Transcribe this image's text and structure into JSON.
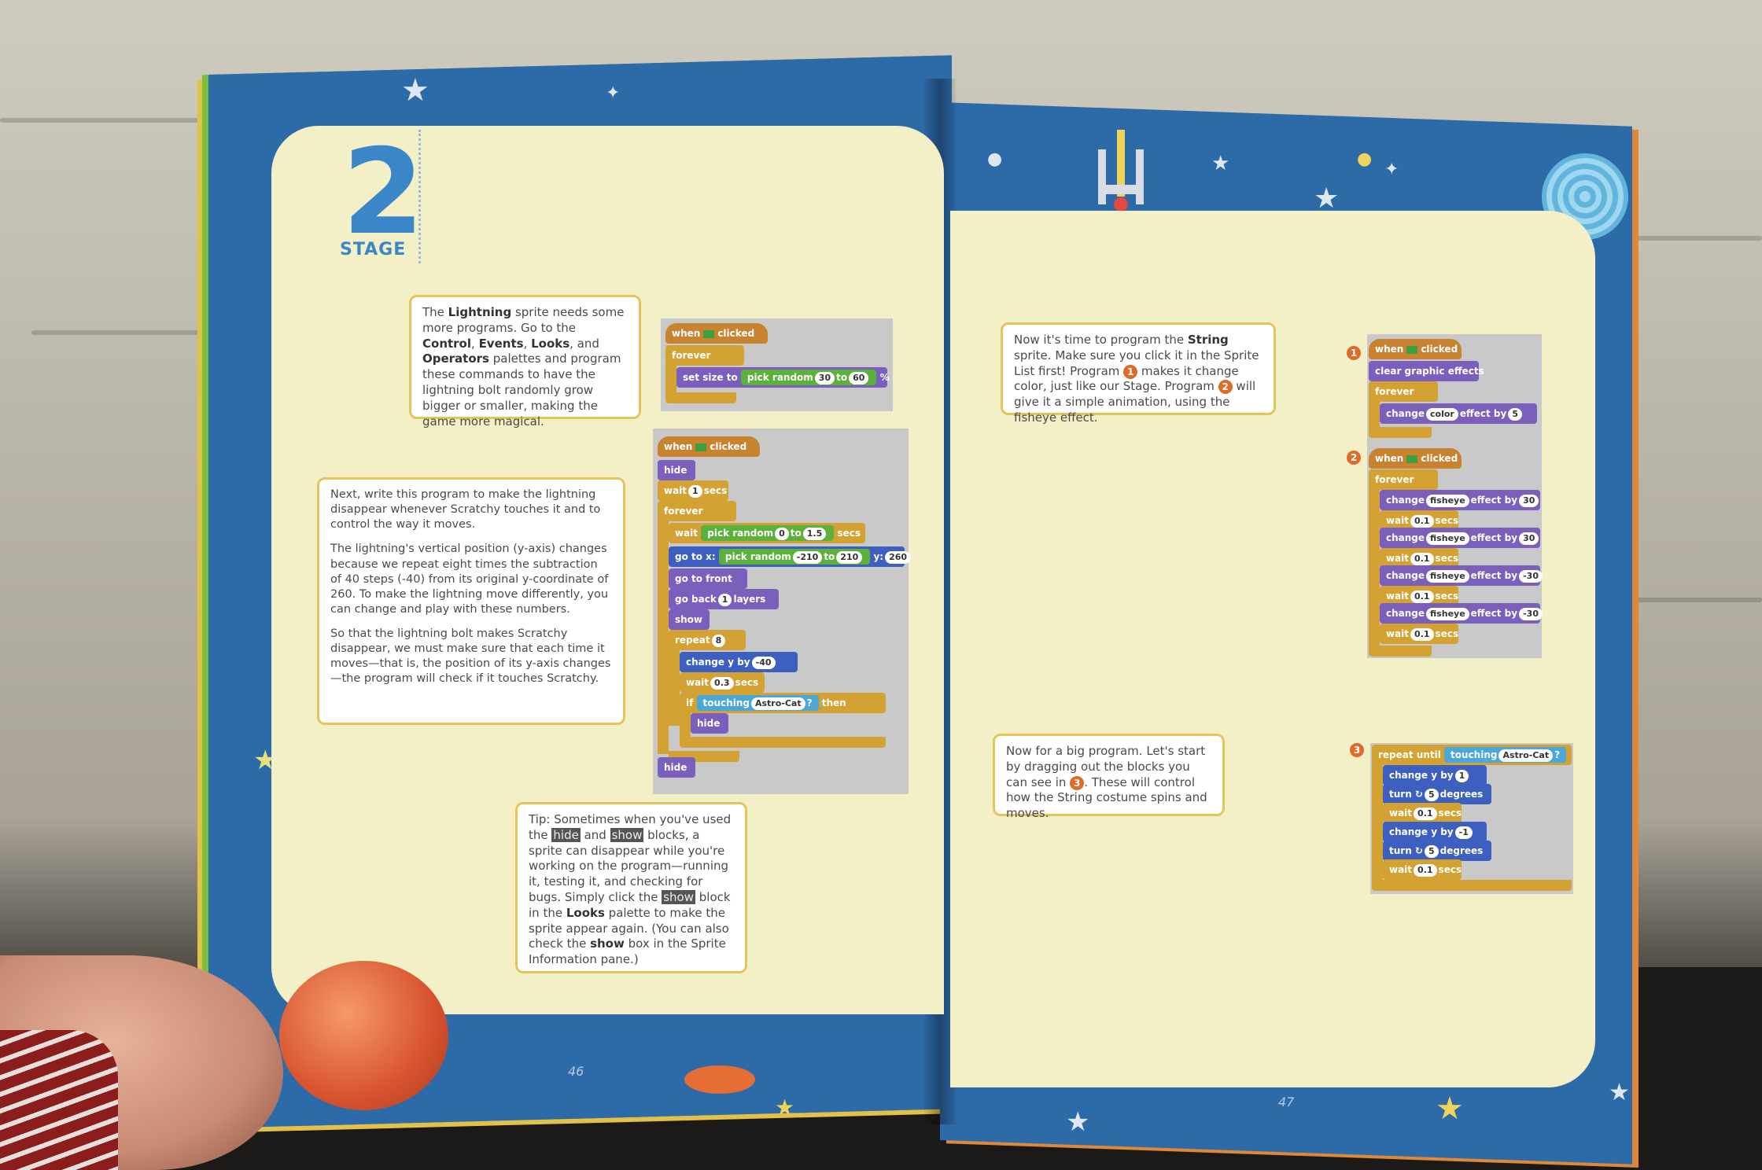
{
  "stage": {
    "number": "2",
    "word": "STAGE"
  },
  "left_page": {
    "page_number": "46",
    "note1": {
      "t1": "The ",
      "b1": "Lightning",
      "t2": " sprite needs some more programs. Go to the ",
      "b2": "Control",
      "t3": ", ",
      "b3": "Events",
      "t4": ", ",
      "b4": "Looks",
      "t5": ", and ",
      "b5": "Operators",
      "t6": " palettes and program these commands to have the lightning bolt randomly grow bigger or smaller, making the game more magical."
    },
    "note2": {
      "p1": "Next, write this program to make the lightning disappear whenever Scratchy touches it and to control the way it moves.",
      "p2": "The lightning's vertical position (y-axis) changes because we repeat eight times the subtraction of 40 steps (-40) from its original y-coordinate of 260. To make the lightning move differently, you can change and play with these numbers.",
      "p3": "So that the lightning bolt makes Scratchy disappear, we must make sure that each time it moves—that is, the position of its y-axis changes—the program will check if it touches Scratchy."
    },
    "tip": {
      "t1": "Tip: Sometimes when you've used the ",
      "h1": "hide",
      "t2": " and ",
      "h2": "show",
      "t3": " blocks, a sprite can disappear while you're working on the program—running it, testing it, and checking for bugs. Simply click the ",
      "h3": "show",
      "t4": " block in the ",
      "b1": "Looks",
      "t5": " palette to make the sprite appear again. (You can also check the ",
      "b2": "show",
      "t6": " box in the Sprite Information pane.)"
    },
    "code1": {
      "when": "when",
      "clicked": "clicked",
      "forever": "forever",
      "set_size": "set size to",
      "pick_random": "pick random",
      "to": "to",
      "a": "30",
      "b": "60",
      "pct": "%"
    },
    "code2": {
      "when": "when",
      "clicked": "clicked",
      "hide": "hide",
      "wait": "wait",
      "w1": "1",
      "secs": "secs",
      "forever": "forever",
      "pick_random": "pick random",
      "to": "to",
      "r1": "0",
      "r2": "1.5",
      "goto": "go to x:",
      "x1": "-210",
      "x2": "210",
      "y": "y:",
      "yv": "260",
      "front": "go to front",
      "goback": "go back",
      "layers_n": "1",
      "layers": "layers",
      "show": "show",
      "repeat": "repeat",
      "rep_n": "8",
      "changey": "change y by",
      "dy": "-40",
      "w2": "0.3",
      "if": "if",
      "touching": "touching",
      "target": "Astro-Cat",
      "q": "?",
      "then": "then"
    }
  },
  "right_page": {
    "page_number": "47",
    "note1": {
      "t1": "Now it's time to program the ",
      "b1": "String",
      "t2": " sprite. Make sure you click it in the Sprite List first! Program ",
      "n1": "1",
      "t3": " makes it change color, just like our Stage. Program ",
      "n2": "2",
      "t4": " will give it a simple animation, using the fisheye effect."
    },
    "note2": {
      "t1": "Now for a big program. Let's start by dragging out the blocks you can see in ",
      "n3": "3",
      "t2": ". These will control how the String costume spins and moves."
    },
    "badges": [
      "1",
      "2",
      "3"
    ],
    "prog1": {
      "when": "when",
      "clicked": "clicked",
      "clear": "clear graphic effects",
      "forever": "forever",
      "change": "change",
      "effect": "color",
      "by": "effect by",
      "val": "5"
    },
    "prog2": {
      "when": "when",
      "clicked": "clicked",
      "forever": "forever",
      "change": "change",
      "effect": "fisheye",
      "by": "effect by",
      "wait": "wait",
      "secs": "secs",
      "v1": "30",
      "v2": "30",
      "v3": "-30",
      "v4": "-30",
      "w": "0.1"
    },
    "prog3": {
      "repeat_until": "repeat until",
      "touching": "touching",
      "target": "Astro-Cat",
      "q": "?",
      "changey": "change y by",
      "dy1": "1",
      "dy2": "-1",
      "turn": "turn ↻",
      "deg": "5",
      "degrees": "degrees",
      "wait": "wait",
      "w": "0.1",
      "secs": "secs"
    }
  },
  "colors": {
    "page_blue": "#2d6aa8",
    "paper": "#f3efc6",
    "note_border": "#e5c55a",
    "events": "#c88330",
    "control": "#d3a232",
    "looks": "#7a5fbd",
    "motion": "#3d5fbf",
    "operators": "#5cb03c",
    "sensing": "#4aa7d8"
  }
}
